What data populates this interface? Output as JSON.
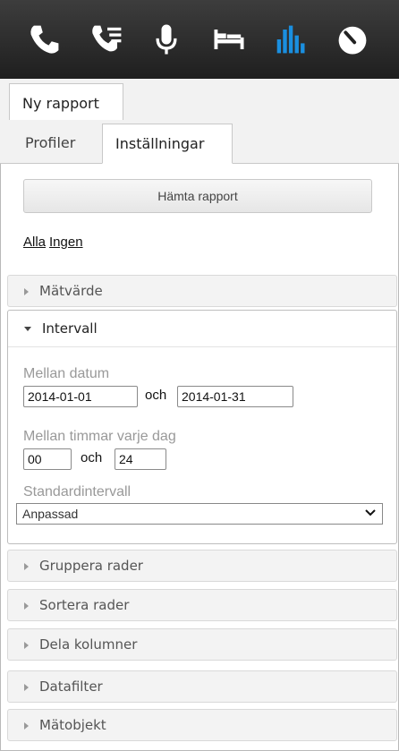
{
  "toolbar": {
    "icons": [
      "phone-icon",
      "call-list-icon",
      "microphone-icon",
      "bed-icon",
      "bar-chart-icon",
      "gauge-icon"
    ],
    "active_color": "#1a8fe0",
    "default_color": "#ffffff"
  },
  "tabs_top": {
    "label": "Ny rapport"
  },
  "tabs_sub": [
    {
      "label": "Profiler"
    },
    {
      "label": "Inställningar"
    }
  ],
  "report_button": "Hämta rapport",
  "select_links": {
    "all": "Alla",
    "none": "Ingen"
  },
  "sections_before": [
    {
      "label": "Mätvärde"
    }
  ],
  "interval": {
    "label": "Intervall",
    "date_label": "Mellan datum",
    "date_from": "2014-01-01",
    "date_and": "och",
    "date_to": "2014-01-31",
    "hours_label": "Mellan timmar varje dag",
    "hour_from": "00",
    "hour_and": "och",
    "hour_to": "24",
    "standard_label": "Standardintervall",
    "standard_value": "Anpassad"
  },
  "sections_after": [
    {
      "label": "Gruppera rader"
    },
    {
      "label": "Sortera rader"
    },
    {
      "label": "Dela kolumner"
    },
    {
      "label": "Datafilter"
    },
    {
      "label": "Mätobjekt"
    }
  ]
}
